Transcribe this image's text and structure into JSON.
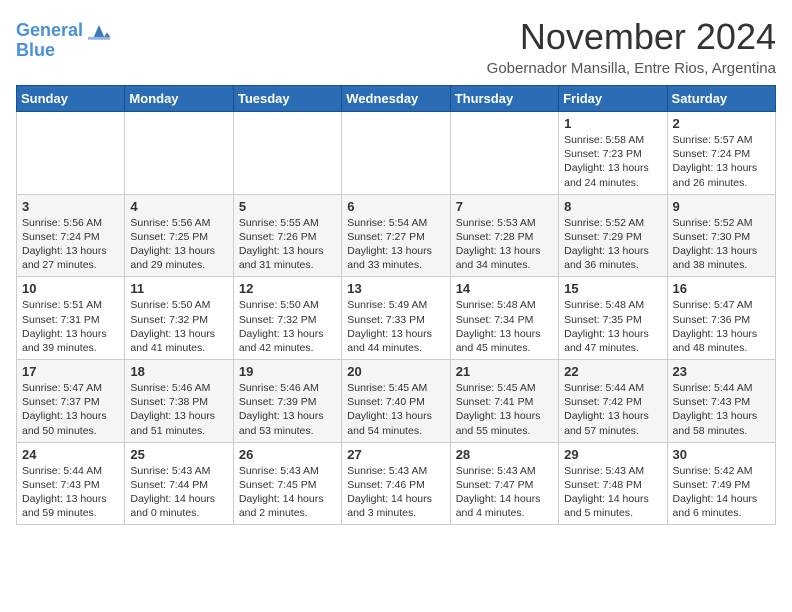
{
  "header": {
    "logo_line1": "General",
    "logo_line2": "Blue",
    "main_title": "November 2024",
    "subtitle": "Gobernador Mansilla, Entre Rios, Argentina"
  },
  "weekdays": [
    "Sunday",
    "Monday",
    "Tuesday",
    "Wednesday",
    "Thursday",
    "Friday",
    "Saturday"
  ],
  "weeks": [
    [
      {
        "day": "",
        "detail": ""
      },
      {
        "day": "",
        "detail": ""
      },
      {
        "day": "",
        "detail": ""
      },
      {
        "day": "",
        "detail": ""
      },
      {
        "day": "",
        "detail": ""
      },
      {
        "day": "1",
        "detail": "Sunrise: 5:58 AM\nSunset: 7:23 PM\nDaylight: 13 hours\nand 24 minutes."
      },
      {
        "day": "2",
        "detail": "Sunrise: 5:57 AM\nSunset: 7:24 PM\nDaylight: 13 hours\nand 26 minutes."
      }
    ],
    [
      {
        "day": "3",
        "detail": "Sunrise: 5:56 AM\nSunset: 7:24 PM\nDaylight: 13 hours\nand 27 minutes."
      },
      {
        "day": "4",
        "detail": "Sunrise: 5:56 AM\nSunset: 7:25 PM\nDaylight: 13 hours\nand 29 minutes."
      },
      {
        "day": "5",
        "detail": "Sunrise: 5:55 AM\nSunset: 7:26 PM\nDaylight: 13 hours\nand 31 minutes."
      },
      {
        "day": "6",
        "detail": "Sunrise: 5:54 AM\nSunset: 7:27 PM\nDaylight: 13 hours\nand 33 minutes."
      },
      {
        "day": "7",
        "detail": "Sunrise: 5:53 AM\nSunset: 7:28 PM\nDaylight: 13 hours\nand 34 minutes."
      },
      {
        "day": "8",
        "detail": "Sunrise: 5:52 AM\nSunset: 7:29 PM\nDaylight: 13 hours\nand 36 minutes."
      },
      {
        "day": "9",
        "detail": "Sunrise: 5:52 AM\nSunset: 7:30 PM\nDaylight: 13 hours\nand 38 minutes."
      }
    ],
    [
      {
        "day": "10",
        "detail": "Sunrise: 5:51 AM\nSunset: 7:31 PM\nDaylight: 13 hours\nand 39 minutes."
      },
      {
        "day": "11",
        "detail": "Sunrise: 5:50 AM\nSunset: 7:32 PM\nDaylight: 13 hours\nand 41 minutes."
      },
      {
        "day": "12",
        "detail": "Sunrise: 5:50 AM\nSunset: 7:32 PM\nDaylight: 13 hours\nand 42 minutes."
      },
      {
        "day": "13",
        "detail": "Sunrise: 5:49 AM\nSunset: 7:33 PM\nDaylight: 13 hours\nand 44 minutes."
      },
      {
        "day": "14",
        "detail": "Sunrise: 5:48 AM\nSunset: 7:34 PM\nDaylight: 13 hours\nand 45 minutes."
      },
      {
        "day": "15",
        "detail": "Sunrise: 5:48 AM\nSunset: 7:35 PM\nDaylight: 13 hours\nand 47 minutes."
      },
      {
        "day": "16",
        "detail": "Sunrise: 5:47 AM\nSunset: 7:36 PM\nDaylight: 13 hours\nand 48 minutes."
      }
    ],
    [
      {
        "day": "17",
        "detail": "Sunrise: 5:47 AM\nSunset: 7:37 PM\nDaylight: 13 hours\nand 50 minutes."
      },
      {
        "day": "18",
        "detail": "Sunrise: 5:46 AM\nSunset: 7:38 PM\nDaylight: 13 hours\nand 51 minutes."
      },
      {
        "day": "19",
        "detail": "Sunrise: 5:46 AM\nSunset: 7:39 PM\nDaylight: 13 hours\nand 53 minutes."
      },
      {
        "day": "20",
        "detail": "Sunrise: 5:45 AM\nSunset: 7:40 PM\nDaylight: 13 hours\nand 54 minutes."
      },
      {
        "day": "21",
        "detail": "Sunrise: 5:45 AM\nSunset: 7:41 PM\nDaylight: 13 hours\nand 55 minutes."
      },
      {
        "day": "22",
        "detail": "Sunrise: 5:44 AM\nSunset: 7:42 PM\nDaylight: 13 hours\nand 57 minutes."
      },
      {
        "day": "23",
        "detail": "Sunrise: 5:44 AM\nSunset: 7:43 PM\nDaylight: 13 hours\nand 58 minutes."
      }
    ],
    [
      {
        "day": "24",
        "detail": "Sunrise: 5:44 AM\nSunset: 7:43 PM\nDaylight: 13 hours\nand 59 minutes."
      },
      {
        "day": "25",
        "detail": "Sunrise: 5:43 AM\nSunset: 7:44 PM\nDaylight: 14 hours\nand 0 minutes."
      },
      {
        "day": "26",
        "detail": "Sunrise: 5:43 AM\nSunset: 7:45 PM\nDaylight: 14 hours\nand 2 minutes."
      },
      {
        "day": "27",
        "detail": "Sunrise: 5:43 AM\nSunset: 7:46 PM\nDaylight: 14 hours\nand 3 minutes."
      },
      {
        "day": "28",
        "detail": "Sunrise: 5:43 AM\nSunset: 7:47 PM\nDaylight: 14 hours\nand 4 minutes."
      },
      {
        "day": "29",
        "detail": "Sunrise: 5:43 AM\nSunset: 7:48 PM\nDaylight: 14 hours\nand 5 minutes."
      },
      {
        "day": "30",
        "detail": "Sunrise: 5:42 AM\nSunset: 7:49 PM\nDaylight: 14 hours\nand 6 minutes."
      }
    ]
  ]
}
